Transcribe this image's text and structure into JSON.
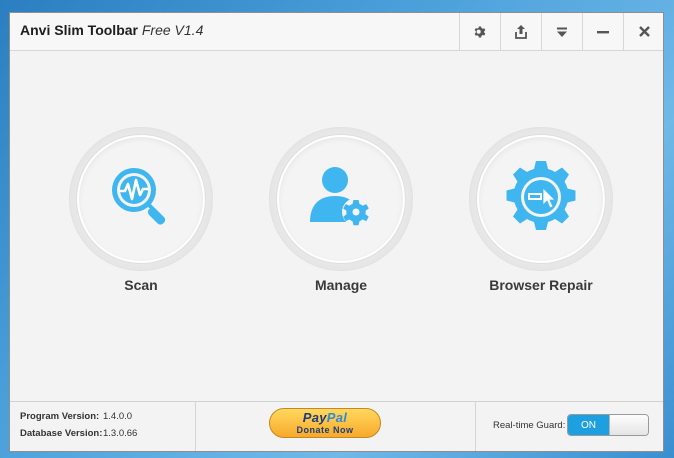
{
  "window": {
    "title_bold": "Anvi Slim Toolbar",
    "title_version": "Free V1.4"
  },
  "titlebar_icons": [
    "gear-icon",
    "share-icon",
    "menu-dropdown-icon",
    "minimize-icon",
    "close-icon"
  ],
  "features": [
    {
      "label": "Scan",
      "icon": "scan-magnifier-icon"
    },
    {
      "label": "Manage",
      "icon": "user-gear-icon"
    },
    {
      "label": "Browser Repair",
      "icon": "browser-repair-gear-icon"
    }
  ],
  "footer": {
    "program_version_label": "Program Version:",
    "program_version": "1.4.0.0",
    "database_version_label": "Database Version:",
    "database_version": "1.3.0.66",
    "paypal_logo_1": "Pay",
    "paypal_logo_2": "Pal",
    "paypal_sub": "Donate Now",
    "guard_label": "Real-time Guard:",
    "guard_state": "ON"
  },
  "colors": {
    "accent": "#1e9fe0",
    "icon_blue": "#3fb6f0",
    "window_bg": "#f3f3f3"
  }
}
